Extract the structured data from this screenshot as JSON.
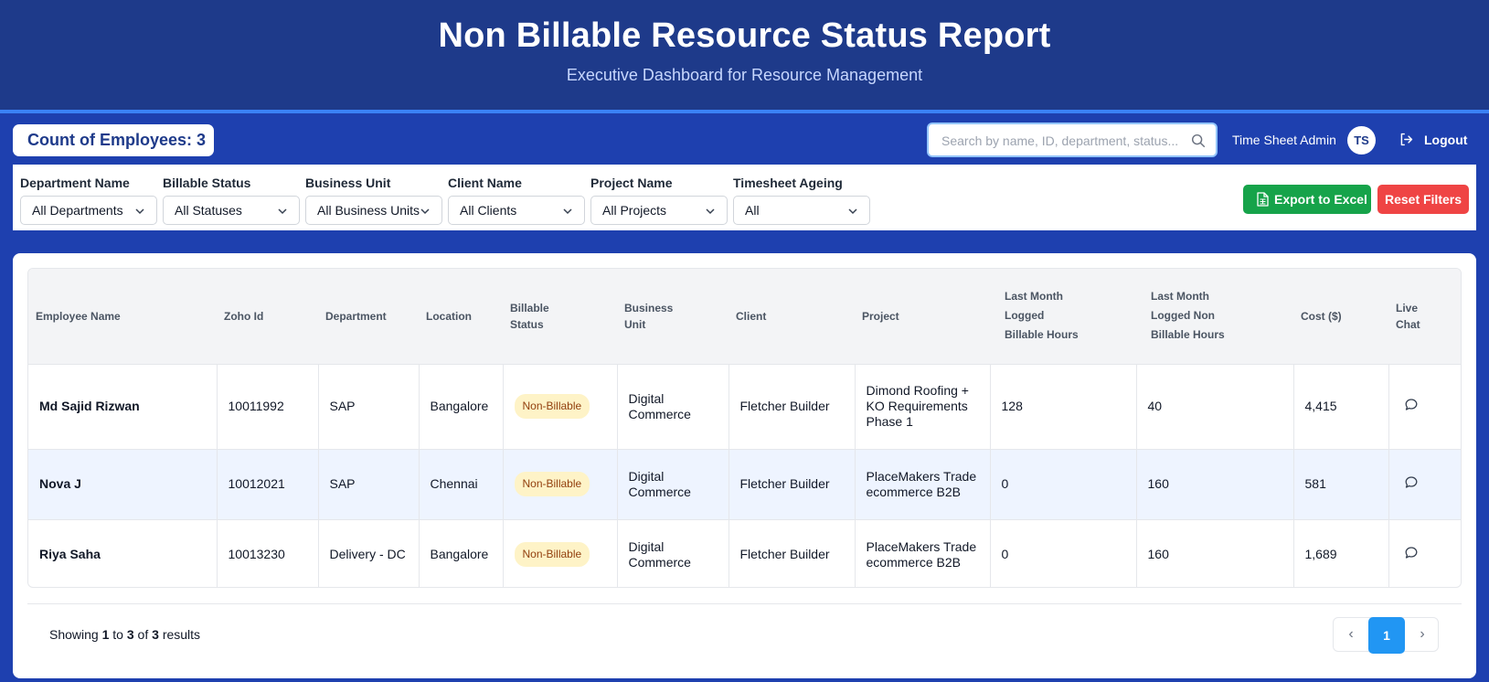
{
  "header": {
    "title": "Non Billable Resource Status Report",
    "subtitle": "Executive Dashboard for Resource Management"
  },
  "toolbar": {
    "count_label": "Count of Employees: 3",
    "search_placeholder": "Search by name, ID, department, status...",
    "user_name": "Time Sheet Admin",
    "avatar_initials": "TS",
    "logout_label": "Logout"
  },
  "filters": [
    {
      "label": "Department Name",
      "value": "All Departments"
    },
    {
      "label": "Billable Status",
      "value": "All Statuses"
    },
    {
      "label": "Business Unit",
      "value": "All Business Units"
    },
    {
      "label": "Client Name",
      "value": "All Clients"
    },
    {
      "label": "Project Name",
      "value": "All Projects"
    },
    {
      "label": "Timesheet Ageing",
      "value": "All"
    }
  ],
  "actions": {
    "export_label": "Export to Excel",
    "reset_label": "Reset Filters"
  },
  "table": {
    "columns": [
      "Employee Name",
      "Zoho Id",
      "Department",
      "Location",
      "Billable Status",
      "Business Unit",
      "Client",
      "Project",
      "Last Month Logged Billable Hours",
      "Last Month Logged Non Billable Hours",
      "Cost ($)",
      "Live Chat"
    ],
    "rows": [
      {
        "name": "Md Sajid Rizwan",
        "zoho_id": "10011992",
        "department": "SAP",
        "location": "Bangalore",
        "status": "Non-Billable",
        "business_unit": "Digital Commerce",
        "client": "Fletcher Builder",
        "project": "Dimond Roofing + KO Requirements Phase 1",
        "billable_hours": "128",
        "non_billable_hours": "40",
        "cost": "4,415"
      },
      {
        "name": "Nova J",
        "zoho_id": "10012021",
        "department": "SAP",
        "location": "Chennai",
        "status": "Non-Billable",
        "business_unit": "Digital Commerce",
        "client": "Fletcher Builder",
        "project": "PlaceMakers Trade ecommerce B2B",
        "billable_hours": "0",
        "non_billable_hours": "160",
        "cost": "581"
      },
      {
        "name": "Riya Saha",
        "zoho_id": "10013230",
        "department": "Delivery - DC",
        "location": "Bangalore",
        "status": "Non-Billable",
        "business_unit": "Digital Commerce",
        "client": "Fletcher Builder",
        "project": "PlaceMakers Trade ecommerce B2B",
        "billable_hours": "0",
        "non_billable_hours": "160",
        "cost": "1,689"
      }
    ]
  },
  "pagination": {
    "prefix": "Showing",
    "from": "1",
    "to_word": "to",
    "to": "3",
    "of_word": "of",
    "total": "3",
    "suffix": "results",
    "current_page": "1",
    "prev": "‹",
    "next": "›"
  },
  "colors": {
    "header_bg": "#1e3a8a",
    "page_bg": "#1e40af",
    "export_btn": "#16a34a",
    "reset_btn": "#ef4444",
    "active_page": "#2196f3",
    "badge_bg": "#fef3c7"
  }
}
